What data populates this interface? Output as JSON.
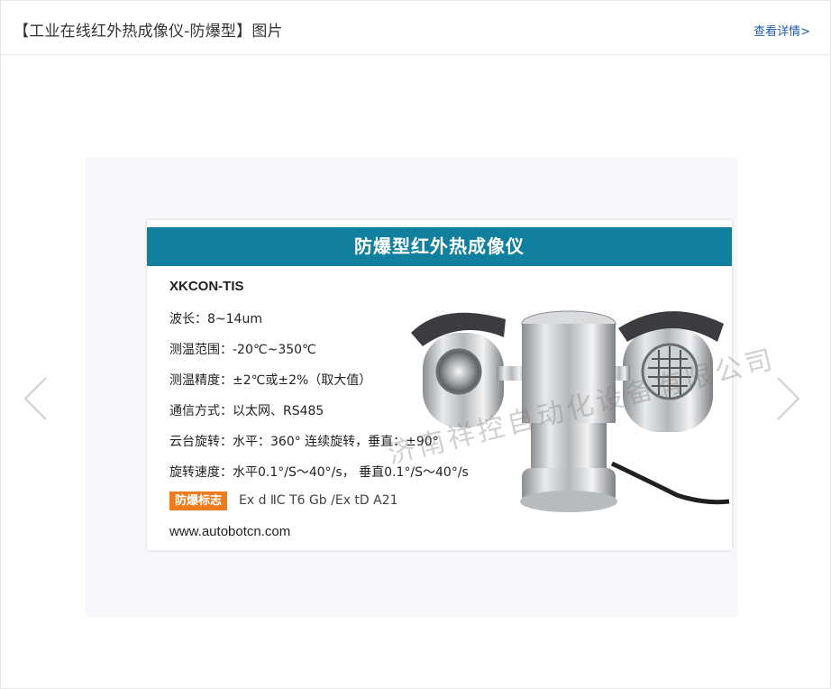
{
  "header": {
    "title": "【工业在线红外热成像仪-防爆型】图片",
    "details_link": "查看详情>"
  },
  "card": {
    "banner": "防爆型红外热成像仪",
    "model": "XKCON-TIS",
    "specs": [
      {
        "label": "波长：",
        "value": "8~14um"
      },
      {
        "label": "测温范围：",
        "value": "-20℃~350℃"
      },
      {
        "label": "测温精度：",
        "value": "±2℃或±2%（取大值）"
      },
      {
        "label": "通信方式：",
        "value": "以太网、RS485"
      },
      {
        "label": "云台旋转：",
        "value": "水平：360° 连续旋转，垂直：±90°"
      },
      {
        "label": "旋转速度：",
        "value": "水平0.1°/S～40°/s，  垂直0.1°/S～40°/s"
      }
    ],
    "ex_mark_label": "防爆标志",
    "ex_mark_value": "Ex d ⅡC T6 Gb /Ex tD A21",
    "website": "www.autobotcn.com",
    "watermark": "济南祥控自动化设备有限公司"
  },
  "colors": {
    "banner": "#11809e",
    "ex_mark": "#ee7b1e",
    "link": "#1e5ba8"
  },
  "icons": {
    "prev": "chevron-left-icon",
    "next": "chevron-right-icon"
  }
}
